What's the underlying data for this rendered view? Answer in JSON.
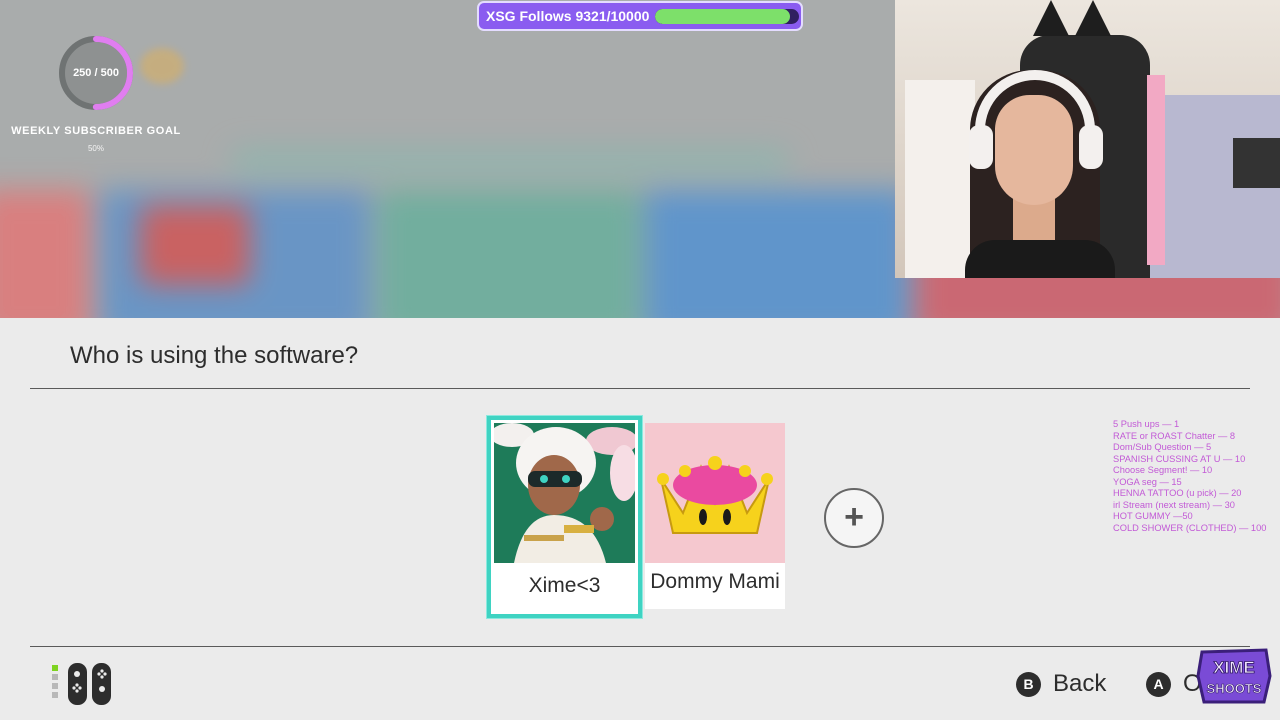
{
  "overlay": {
    "subscriber_goal": {
      "count": "250 / 500",
      "title": "WEEKLY SUBSCRIBER GOAL",
      "percent_label": "50%",
      "progress": 0.5
    },
    "follows": {
      "label": "XSG Follows 9321/10000",
      "progress": 0.9321
    },
    "rewards": [
      "5 Push ups — 1",
      "RATE or ROAST Chatter — 8",
      "Dom/Sub Question — 5",
      "SPANISH CUSSING AT U — 10",
      "Choose Segment! — 10",
      "YOGA seg — 15",
      "HENNA TATTOO (u pick) — 20",
      "irl Stream (next stream) — 30",
      "HOT GUMMY —50",
      "COLD SHOWER (CLOTHED) — 100"
    ],
    "brand_logo": {
      "line1": "XIME",
      "line2": "SHOOTS"
    }
  },
  "switch_ui": {
    "title": "Who is using the software?",
    "users": [
      {
        "name": "Xime<3",
        "avatar": "twintelle-avatar",
        "selected": true
      },
      {
        "name": "Dommy Mami",
        "avatar": "super-crown-avatar",
        "selected": false
      }
    ],
    "add_user_icon": "plus-icon",
    "footer": {
      "back_glyph": "B",
      "back_label": "Back",
      "ok_glyph": "A",
      "ok_label": "O"
    }
  },
  "colors": {
    "selection_border": "#3fd3c2",
    "follows_bar_bg": "#8a5cf0",
    "follows_fill": "#7de06a",
    "subscriber_ring": "#e07ef0",
    "rewards_text": "#c25ad6"
  }
}
